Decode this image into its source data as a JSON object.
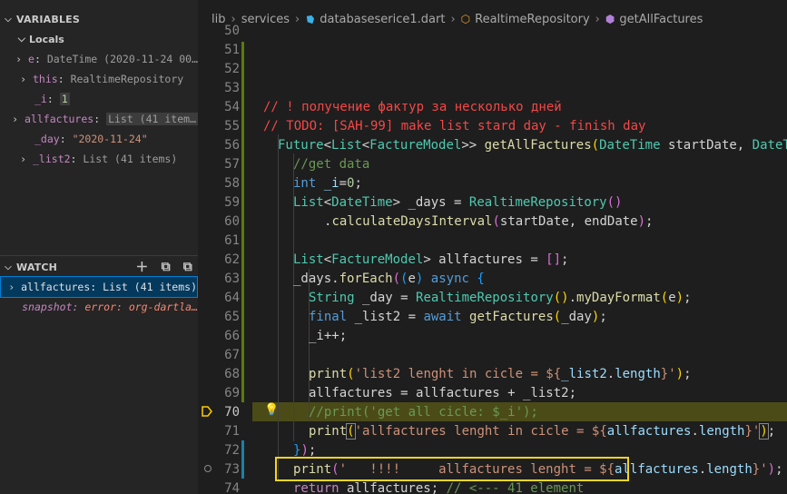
{
  "variables": {
    "header": "VARIABLES",
    "locals_header": "Locals",
    "items": [
      {
        "name": "e",
        "value": "DateTime (2020-11-24 00…",
        "expandable": true
      },
      {
        "name": "this",
        "value": "RealtimeRepository",
        "expandable": true
      },
      {
        "name": "_i",
        "value": "1",
        "expandable": false
      },
      {
        "name": "allfactures",
        "value": "List (41 item…",
        "expandable": true
      },
      {
        "name": "_day",
        "value": "\"2020-11-24\"",
        "expandable": false
      },
      {
        "name": "_list2",
        "value": "List (41 items)",
        "expandable": true
      }
    ]
  },
  "watch": {
    "header": "WATCH",
    "items": [
      {
        "name": "allfactures",
        "value": "List (41 items)",
        "selected": true
      },
      {
        "name": "snapshot",
        "value": "error: org-dartla…",
        "error": true
      }
    ],
    "actions": [
      "add-icon",
      "collapse-all-icon",
      "remove-all-icon"
    ]
  },
  "breadcrumb": {
    "parts": [
      "lib",
      "services",
      "databaseserice1.dart",
      "RealtimeRepository",
      "getAllFactures"
    ]
  },
  "editor": {
    "line_numbers": [
      "50",
      "51",
      "52",
      "53",
      "54",
      "55",
      "56",
      "57",
      "58",
      "59",
      "60",
      "61",
      "62",
      "63",
      "64",
      "65",
      "66",
      "67",
      "68",
      "69",
      "70",
      "71",
      "72",
      "73",
      "74"
    ],
    "current_line": "70",
    "lines": {
      "l53": "// ! получение фактур за несколько дней",
      "l54": "// TODO: [SAH-99] make list stard day - finish day",
      "l56": "//get data",
      "l69": "//print('get all cicle: $_i');",
      "l73_comment": "// <--- 41 element",
      "s67": "'list2 lenght in cicle = ${",
      "s70": "'allfactures lenght in cicle = ${",
      "s72": "'   !!!!     allfactures lenght = ${"
    }
  },
  "colors": {
    "accent_selection": "#04395e",
    "annotation_box": "#f2d621",
    "current_line_bg": "#4b4b18"
  }
}
